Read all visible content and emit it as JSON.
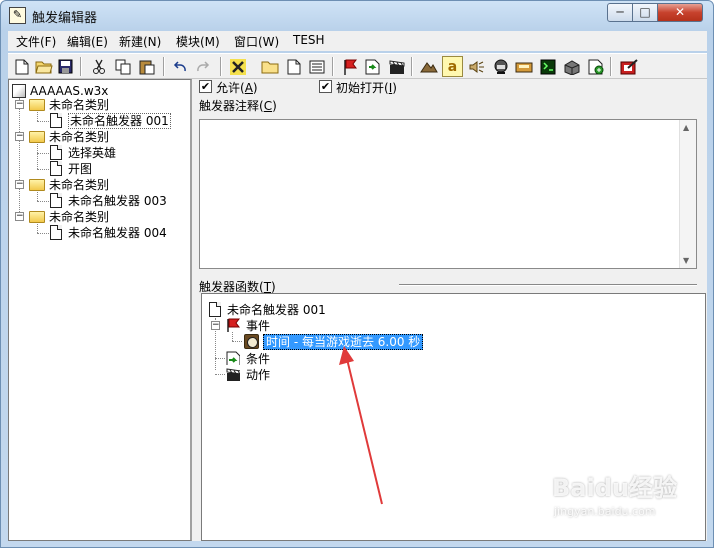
{
  "window": {
    "title": "触发编辑器",
    "app_icon": "trigger-editor-icon",
    "min_glyph": "─",
    "max_glyph": "□",
    "close_glyph": "✕"
  },
  "menu": [
    "文件(F)",
    "编辑(E)",
    "新建(N)",
    "模块(M)",
    "窗口(W)",
    "TESH"
  ],
  "toolbar_icons": [
    "new-file-icon",
    "open-folder-icon",
    "save-icon",
    "cut-icon",
    "copy-icon",
    "paste-icon",
    "undo-icon",
    "redo-icon",
    "close-x-icon",
    "new-category-icon",
    "new-trigger-icon",
    "new-comment-icon",
    "new-event-icon",
    "new-condition-icon",
    "new-action-icon",
    "terrain-editor-icon",
    "trigger-editor-icon",
    "sound-editor-icon",
    "object-editor-icon",
    "campaign-editor-icon",
    "ai-editor-icon",
    "object-manager-icon",
    "import-manager-icon",
    "test-map-icon"
  ],
  "left_tree": {
    "root": "AAAAAS.w3x",
    "categories": [
      {
        "label": "未命名类别",
        "items": [
          "未命名触发器 001"
        ]
      },
      {
        "label": "未命名类别",
        "items": [
          "选择英雄",
          "开图"
        ]
      },
      {
        "label": "未命名类别",
        "items": [
          "未命名触发器 003"
        ]
      },
      {
        "label": "未命名类别",
        "items": [
          "未命名触发器 004"
        ]
      }
    ]
  },
  "options": {
    "enabled_label": "允许",
    "enabled_shortcut": "A",
    "enabled_checked": true,
    "initially_on_label": "初始打开",
    "initially_on_shortcut": "I",
    "initially_on_checked": true
  },
  "comment": {
    "label": "触发器注释",
    "shortcut": "C",
    "value": ""
  },
  "functions": {
    "label": "触发器函数",
    "shortcut": "T",
    "trigger_name": "未命名触发器 001",
    "events_label": "事件",
    "event_item": "时间 - 每当游戏逝去 6.00 秒",
    "conditions_label": "条件",
    "actions_label": "动作"
  },
  "watermark": {
    "brand": "Baidu经验",
    "url": "jingyan.baidu.com"
  }
}
